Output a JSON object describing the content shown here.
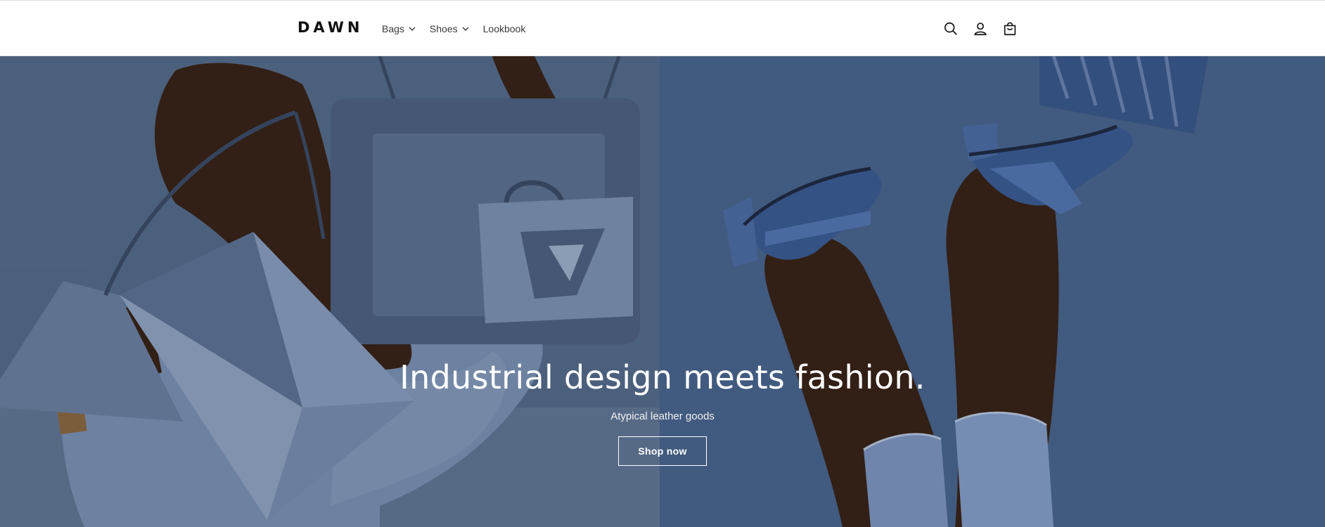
{
  "header": {
    "logo": "DAWN",
    "nav": [
      {
        "label": "Bags",
        "has_dropdown": true
      },
      {
        "label": "Shoes",
        "has_dropdown": true
      },
      {
        "label": "Lookbook",
        "has_dropdown": false
      }
    ],
    "icons": [
      "search-icon",
      "account-icon",
      "cart-icon"
    ]
  },
  "hero": {
    "title": "Industrial design meets fashion.",
    "subtitle": "Atypical leather goods",
    "button_label": "Shop now"
  },
  "colors": {
    "left_background": "#566e8e",
    "right_background": "#4a6791",
    "text_dark": "#121212"
  }
}
